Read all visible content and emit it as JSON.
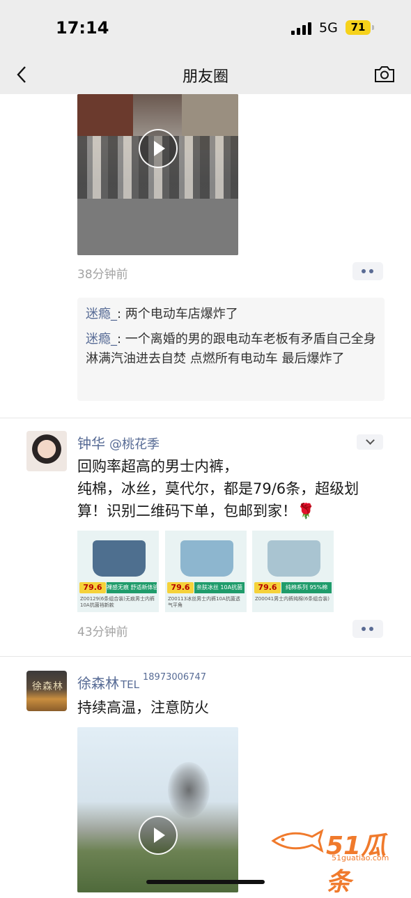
{
  "status_bar": {
    "time": "17:14",
    "network": "5G",
    "battery": "71"
  },
  "nav": {
    "title": "朋友圈"
  },
  "post1": {
    "timestamp": "38分钟前",
    "comments": [
      {
        "user": "迷瘾_",
        "text": ": 两个电动车店爆炸了"
      },
      {
        "user": "迷瘾_",
        "text": ": 一个离婚的男的跟电动车老板有矛盾自己全身淋满汽油进去自焚 点燃所有电动车 最后爆炸了"
      }
    ]
  },
  "post2": {
    "user": "钟华",
    "sub": "@桃花季",
    "text_lines": [
      "回购率超高的男士内裤，",
      "纯棉，冰丝，莫代尔，都是79/6条，超级划算！识别二维码下单，包邮到家！"
    ],
    "rose": "🌹",
    "images": [
      {
        "price": "79.6",
        "band": "裸感无痕 舒适新体验",
        "desc": "Z00129(6条组合装)无痕男士内裤10A抗菌裆新款",
        "color": "#4e6f8f"
      },
      {
        "price": "79.6",
        "band": "亲肤冰丝 10A抗菌",
        "desc": "Z00113冰丝男士内裤10A抗菌透气平角",
        "color": "#8db6cf"
      },
      {
        "price": "79.6",
        "band": "纯棉系列 95%棉",
        "desc": "Z00041男士内裤纯棉(6条组合装)",
        "color": "#a9c4d1"
      }
    ],
    "timestamp": "43分钟前"
  },
  "post3": {
    "user": "徐森林",
    "tel_mark": "TEL",
    "phone": "18973006747",
    "avatar_text": "徐森林",
    "text": "持续高温，注意防火"
  },
  "watermark": {
    "main": "51瓜条",
    "sub": "51guatiao.com"
  }
}
